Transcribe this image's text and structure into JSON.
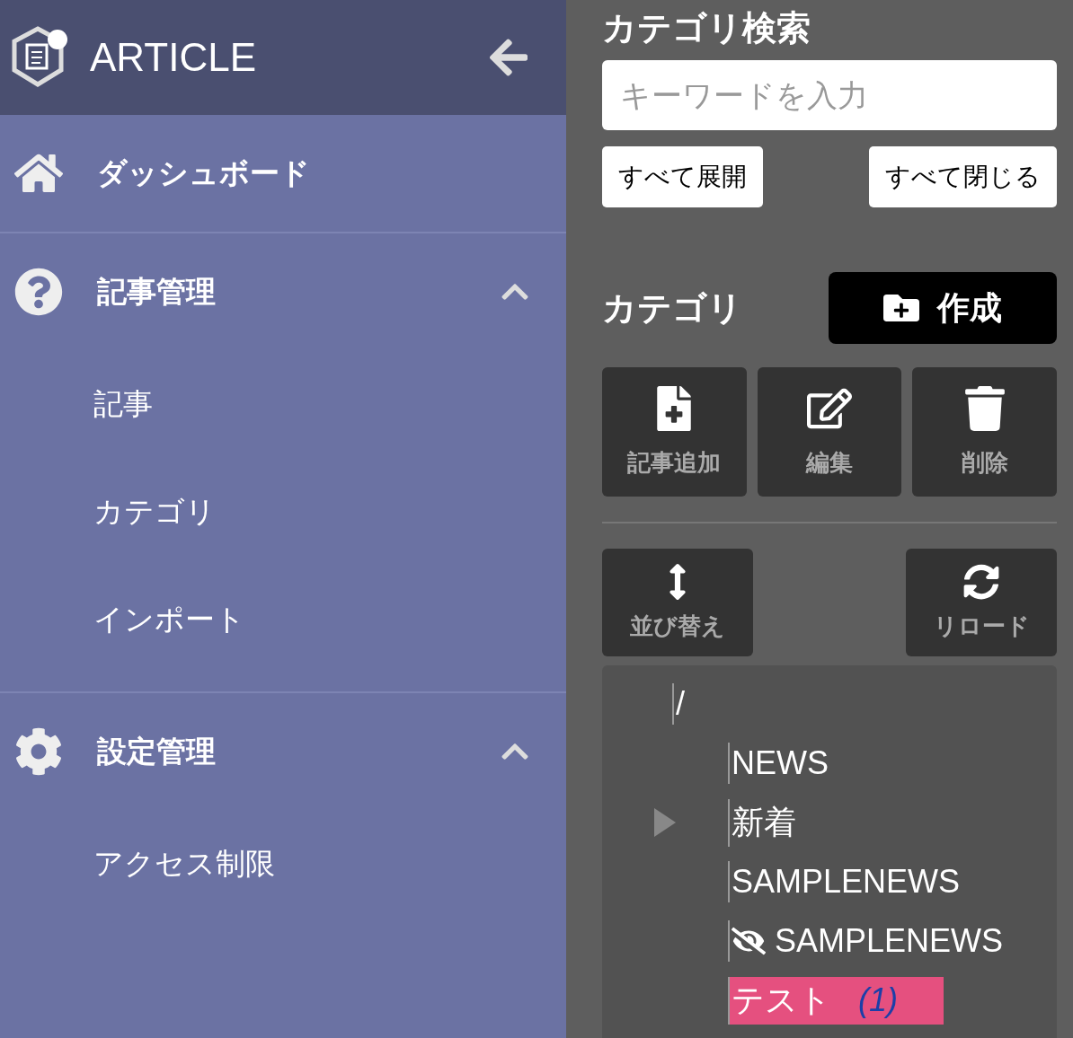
{
  "sidebar": {
    "brand": "ARTICLE",
    "items": [
      {
        "label": "ダッシュボード"
      },
      {
        "label": "記事管理",
        "expanded": true,
        "children": [
          {
            "label": "記事"
          },
          {
            "label": "カテゴリ"
          },
          {
            "label": "インポート"
          }
        ]
      },
      {
        "label": "設定管理",
        "expanded": true,
        "children": [
          {
            "label": "アクセス制限"
          }
        ]
      }
    ]
  },
  "search": {
    "title": "カテゴリ検索",
    "placeholder": "キーワードを入力",
    "expand_all": "すべて展開",
    "collapse_all": "すべて閉じる"
  },
  "category": {
    "title": "カテゴリ",
    "create": "作成",
    "actions": [
      {
        "label": "記事追加"
      },
      {
        "label": "編集"
      },
      {
        "label": "削除"
      }
    ],
    "sort": "並び替え",
    "reload": "リロード"
  },
  "tree": [
    {
      "label": "/",
      "children": [
        {
          "label": "NEWS",
          "selected": false,
          "hidden": false
        },
        {
          "label": "新着",
          "selected": false,
          "hidden": false,
          "expanded": false
        },
        {
          "label": "SAMPLENEWS",
          "selected": false,
          "hidden": false
        },
        {
          "label": "SAMPLENEWS",
          "selected": false,
          "hidden": true
        },
        {
          "label": "テスト",
          "count": "(1)",
          "selected": true,
          "hidden": false
        }
      ]
    }
  ]
}
